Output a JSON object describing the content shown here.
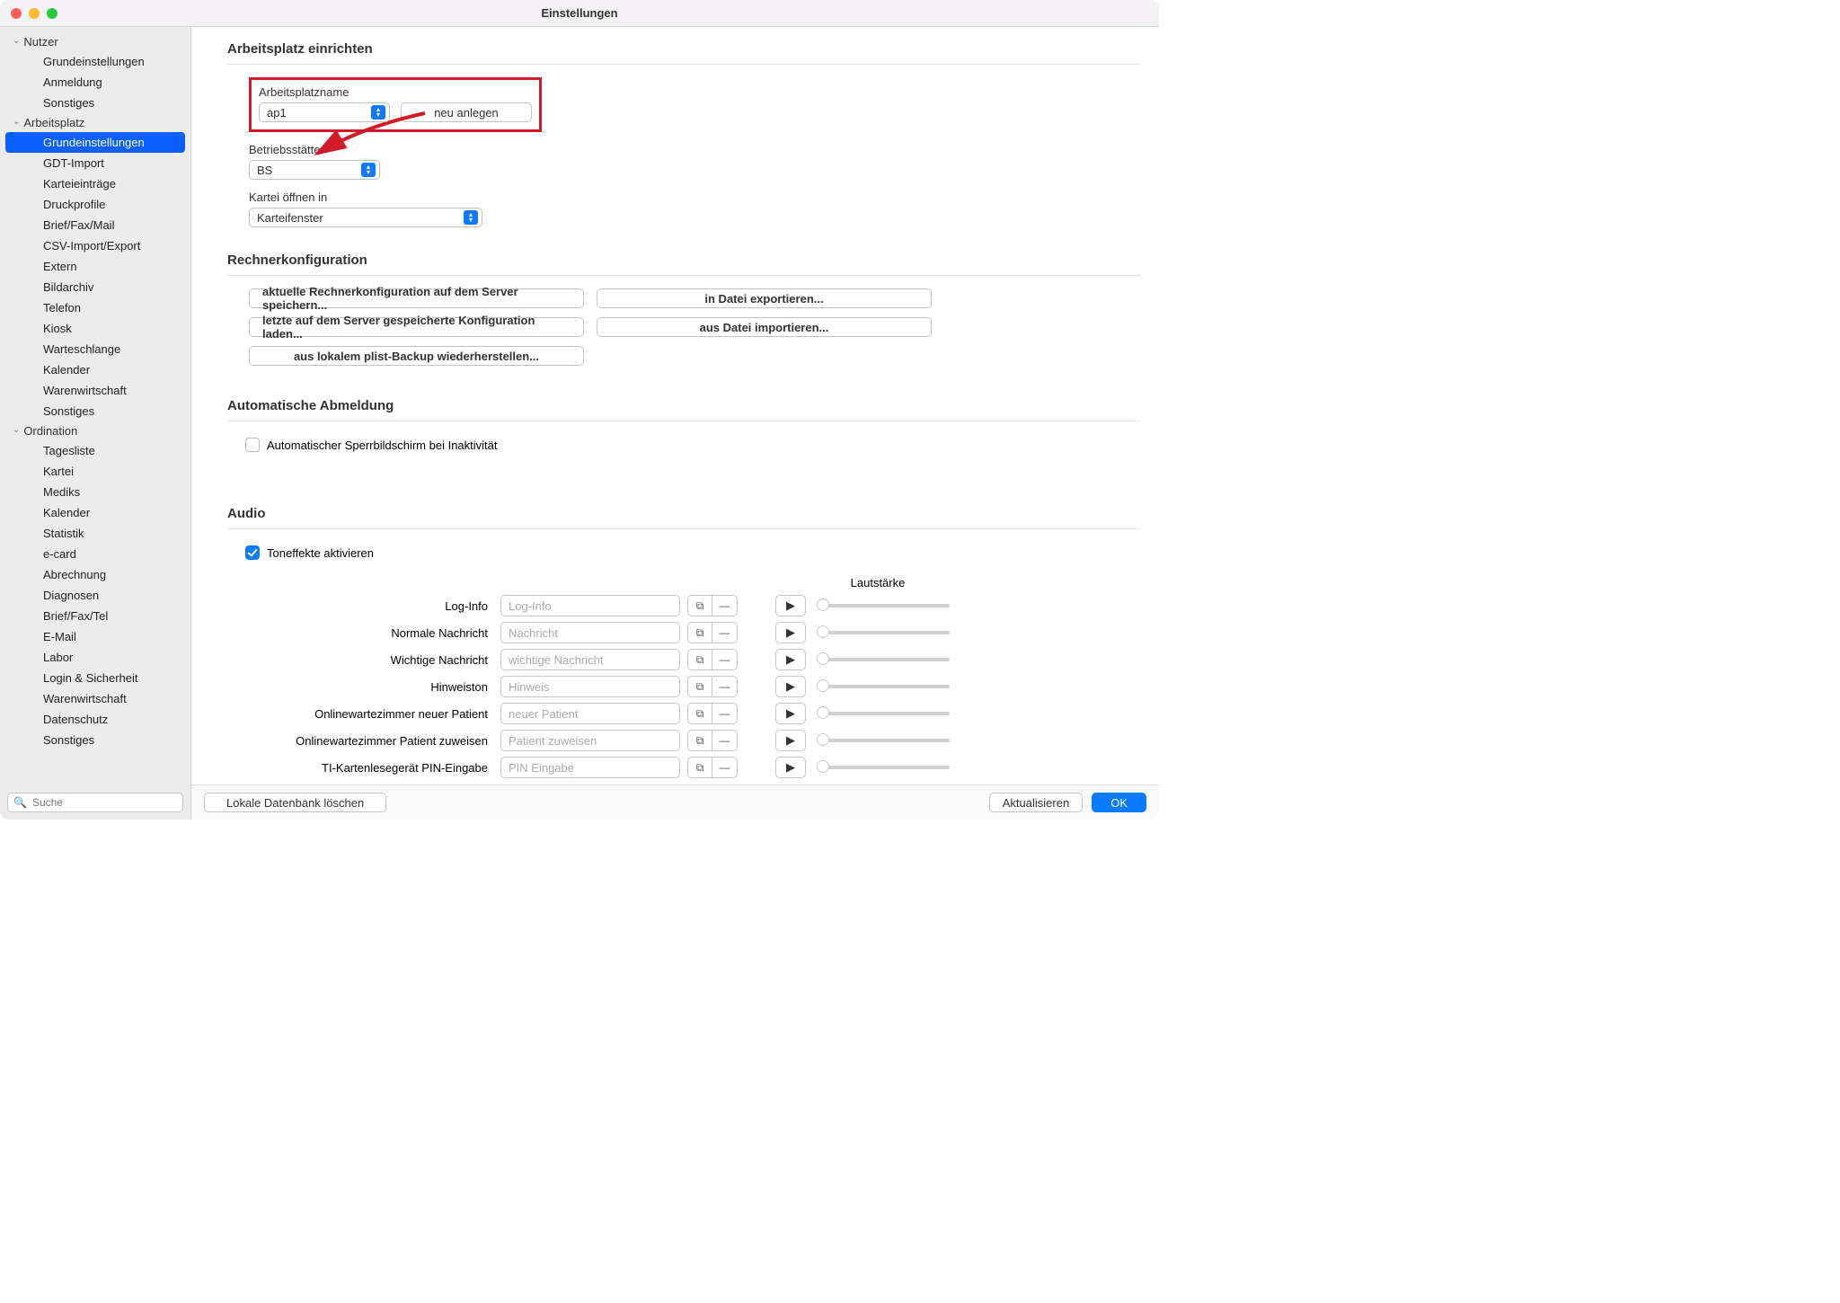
{
  "window": {
    "title": "Einstellungen"
  },
  "sidebar": {
    "search_placeholder": "Suche",
    "groups": [
      {
        "label": "Nutzer",
        "items": [
          {
            "label": "Grundeinstellungen"
          },
          {
            "label": "Anmeldung"
          },
          {
            "label": "Sonstiges"
          }
        ]
      },
      {
        "label": "Arbeitsplatz",
        "items": [
          {
            "label": "Grundeinstellungen",
            "selected": true
          },
          {
            "label": "GDT-Import"
          },
          {
            "label": "Karteieinträge"
          },
          {
            "label": "Druckprofile"
          },
          {
            "label": "Brief/Fax/Mail"
          },
          {
            "label": "CSV-Import/Export"
          },
          {
            "label": "Extern"
          },
          {
            "label": "Bildarchiv"
          },
          {
            "label": "Telefon"
          },
          {
            "label": "Kiosk"
          },
          {
            "label": "Warteschlange"
          },
          {
            "label": "Kalender"
          },
          {
            "label": "Warenwirtschaft"
          },
          {
            "label": "Sonstiges"
          }
        ]
      },
      {
        "label": "Ordination",
        "items": [
          {
            "label": "Tagesliste"
          },
          {
            "label": "Kartei"
          },
          {
            "label": "Mediks"
          },
          {
            "label": "Kalender"
          },
          {
            "label": "Statistik"
          },
          {
            "label": "e-card"
          },
          {
            "label": "Abrechnung"
          },
          {
            "label": "Diagnosen"
          },
          {
            "label": "Brief/Fax/Tel"
          },
          {
            "label": "E-Mail"
          },
          {
            "label": "Labor"
          },
          {
            "label": "Login & Sicherheit"
          },
          {
            "label": "Warenwirtschaft"
          },
          {
            "label": "Datenschutz"
          },
          {
            "label": "Sonstiges"
          }
        ]
      }
    ]
  },
  "main": {
    "setup": {
      "title": "Arbeitsplatz einrichten",
      "workplace_label": "Arbeitsplatzname",
      "workplace_value": "ap1",
      "new_btn": "neu anlegen",
      "site_label": "Betriebsstätte",
      "site_value": "BS",
      "open_label": "Kartei öffnen in",
      "open_value": "Karteifenster"
    },
    "config": {
      "title": "Rechnerkonfiguration",
      "save_server": "aktuelle Rechnerkonfiguration auf dem Server speichern...",
      "export_file": "in Datei exportieren...",
      "load_server": "letzte auf dem Server gespeicherte Konfiguration laden...",
      "import_file": "aus Datei importieren...",
      "restore_plist": "aus lokalem plist-Backup wiederherstellen..."
    },
    "logout": {
      "title": "Automatische Abmeldung",
      "lock_label": "Automatischer Sperrbildschirm bei Inaktivität",
      "lock_checked": false
    },
    "audio": {
      "title": "Audio",
      "enable_label": "Toneffekte aktivieren",
      "enable_checked": true,
      "volume_header": "Lautstärke",
      "rows": [
        {
          "label": "Log-Info",
          "placeholder": "Log-Info"
        },
        {
          "label": "Normale Nachricht",
          "placeholder": "Nachricht"
        },
        {
          "label": "Wichtige Nachricht",
          "placeholder": "wichtige Nachricht"
        },
        {
          "label": "Hinweiston",
          "placeholder": "Hinweis"
        },
        {
          "label": "Onlinewartezimmer neuer Patient",
          "placeholder": "neuer Patient"
        },
        {
          "label": "Onlinewartezimmer Patient zuweisen",
          "placeholder": "Patient zuweisen"
        },
        {
          "label": "TI-Kartenlesegerät PIN-Eingabe",
          "placeholder": "PIN Eingabe"
        }
      ]
    }
  },
  "footer": {
    "delete_db": "Lokale Datenbank löschen",
    "refresh": "Aktualisieren",
    "ok": "OK"
  },
  "annotation": {
    "highlight_color": "#d11a2a"
  }
}
